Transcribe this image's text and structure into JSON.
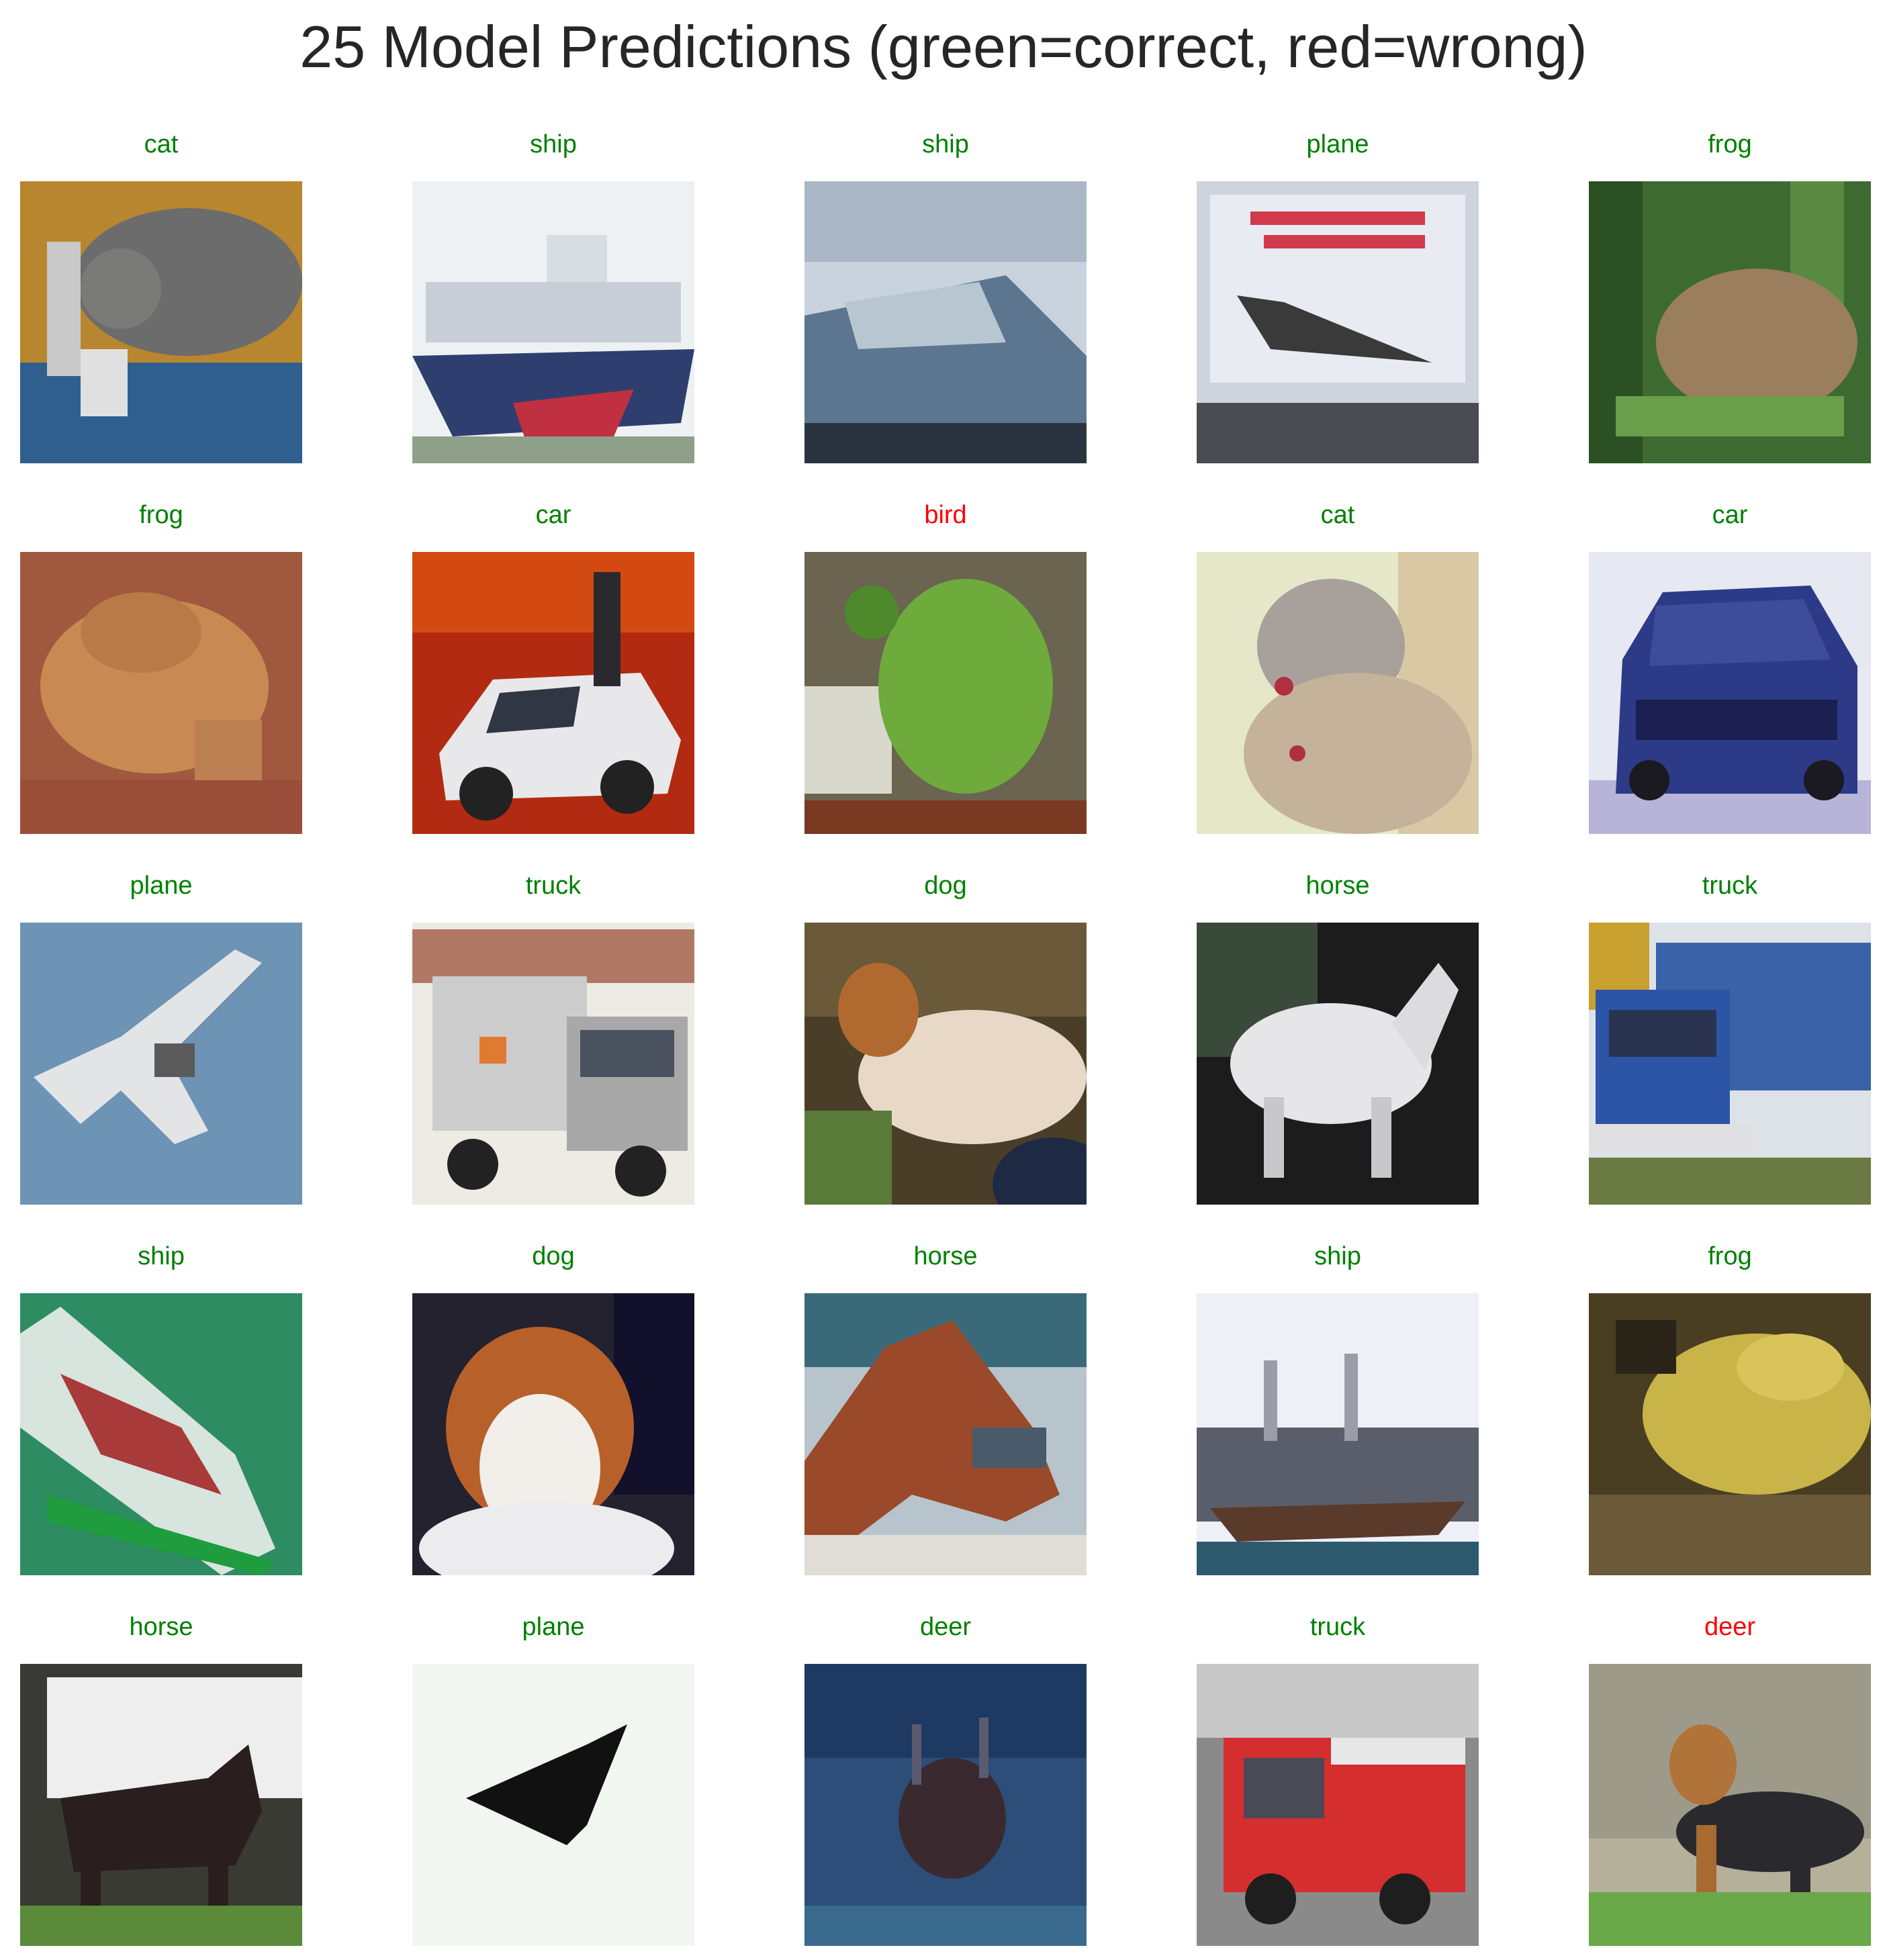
{
  "title": "25 Model Predictions (green=correct, red=wrong)",
  "legend_colors": {
    "correct": "#008000",
    "wrong": "#ff0000"
  },
  "predictions": [
    {
      "label": "cat",
      "correct": true,
      "subject": "cat-image"
    },
    {
      "label": "ship",
      "correct": true,
      "subject": "ship-image"
    },
    {
      "label": "ship",
      "correct": true,
      "subject": "ship-image"
    },
    {
      "label": "plane",
      "correct": true,
      "subject": "plane-image"
    },
    {
      "label": "frog",
      "correct": true,
      "subject": "frog-image"
    },
    {
      "label": "frog",
      "correct": true,
      "subject": "frog-image"
    },
    {
      "label": "car",
      "correct": true,
      "subject": "car-image"
    },
    {
      "label": "bird",
      "correct": false,
      "subject": "frog-image"
    },
    {
      "label": "cat",
      "correct": true,
      "subject": "cat-image"
    },
    {
      "label": "car",
      "correct": true,
      "subject": "car-image"
    },
    {
      "label": "plane",
      "correct": true,
      "subject": "plane-image"
    },
    {
      "label": "truck",
      "correct": true,
      "subject": "truck-image"
    },
    {
      "label": "dog",
      "correct": true,
      "subject": "dog-image"
    },
    {
      "label": "horse",
      "correct": true,
      "subject": "horse-image"
    },
    {
      "label": "truck",
      "correct": true,
      "subject": "truck-image"
    },
    {
      "label": "ship",
      "correct": true,
      "subject": "ship-image"
    },
    {
      "label": "dog",
      "correct": true,
      "subject": "dog-image"
    },
    {
      "label": "horse",
      "correct": true,
      "subject": "horse-image"
    },
    {
      "label": "ship",
      "correct": true,
      "subject": "ship-image"
    },
    {
      "label": "frog",
      "correct": true,
      "subject": "frog-image"
    },
    {
      "label": "horse",
      "correct": true,
      "subject": "horse-image"
    },
    {
      "label": "plane",
      "correct": true,
      "subject": "plane-image"
    },
    {
      "label": "deer",
      "correct": true,
      "subject": "deer-image"
    },
    {
      "label": "truck",
      "correct": true,
      "subject": "truck-image"
    },
    {
      "label": "deer",
      "correct": false,
      "subject": "dog-image"
    }
  ]
}
